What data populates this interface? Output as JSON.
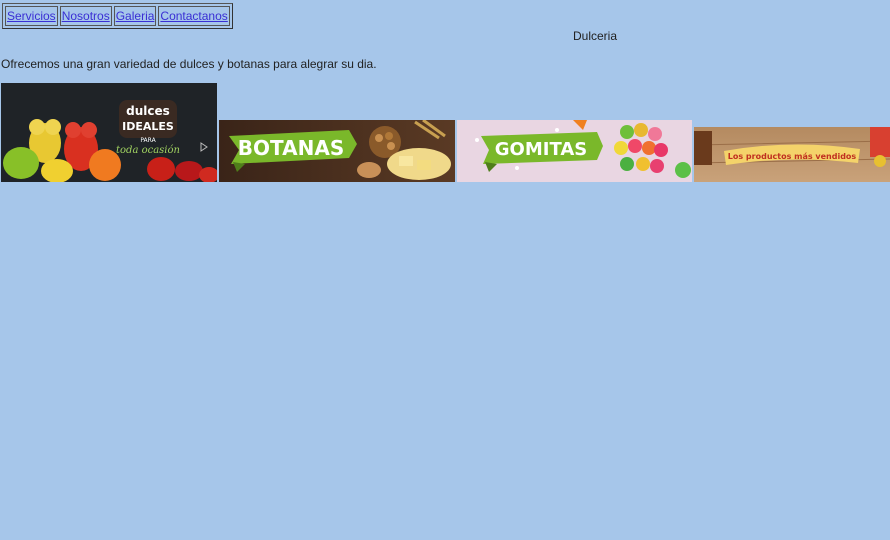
{
  "nav": {
    "items": [
      {
        "label": "Servicios"
      },
      {
        "label": "Nosotros"
      },
      {
        "label": "Galeria"
      },
      {
        "label": "Contactanos"
      }
    ]
  },
  "header": {
    "title": "Dulceria"
  },
  "main": {
    "tagline": "Ofrecemos una gran variedad de dulces y botanas para alegrar su dia."
  },
  "banners": [
    {
      "line1": "dulces",
      "line2": "IDEALES",
      "line3": "PARA",
      "line4": "toda ocasión"
    },
    {
      "label": "BOTANAS"
    },
    {
      "label": "GOMITAS"
    },
    {
      "label": "Los productos más vendidos"
    }
  ]
}
